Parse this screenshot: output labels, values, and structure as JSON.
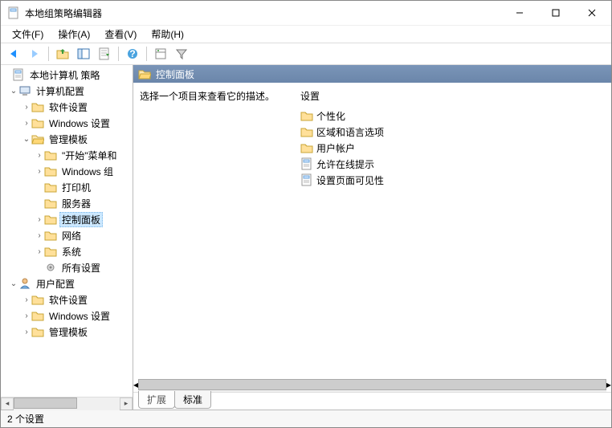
{
  "window": {
    "title": "本地组策略编辑器"
  },
  "menu": {
    "file": "文件(F)",
    "action": "操作(A)",
    "view": "查看(V)",
    "help": "帮助(H)"
  },
  "tree": {
    "root": "本地计算机 策略",
    "computer_cfg": "计算机配置",
    "software_settings": "软件设置",
    "windows_settings": "Windows 设置",
    "admin_templates": "管理模板",
    "start_menu": "\"开始\"菜单和",
    "windows_components": "Windows 组",
    "printers": "打印机",
    "server": "服务器",
    "control_panel": "控制面板",
    "network": "网络",
    "system": "系统",
    "all_settings": "所有设置",
    "user_cfg": "用户配置",
    "user_software": "软件设置",
    "user_windows": "Windows 设置",
    "user_admin": "管理模板"
  },
  "detail": {
    "header": "控制面板",
    "description_prompt": "选择一个项目来查看它的描述。",
    "settings_heading": "设置",
    "items": {
      "personalization": "个性化",
      "region_language": "区域和语言选项",
      "user_accounts": "用户帐户",
      "allow_online_tips": "允许在线提示",
      "settings_page_visibility": "设置页面可见性"
    }
  },
  "tabs": {
    "extended": "扩展",
    "standard": "标准"
  },
  "status": {
    "text": "2 个设置"
  }
}
